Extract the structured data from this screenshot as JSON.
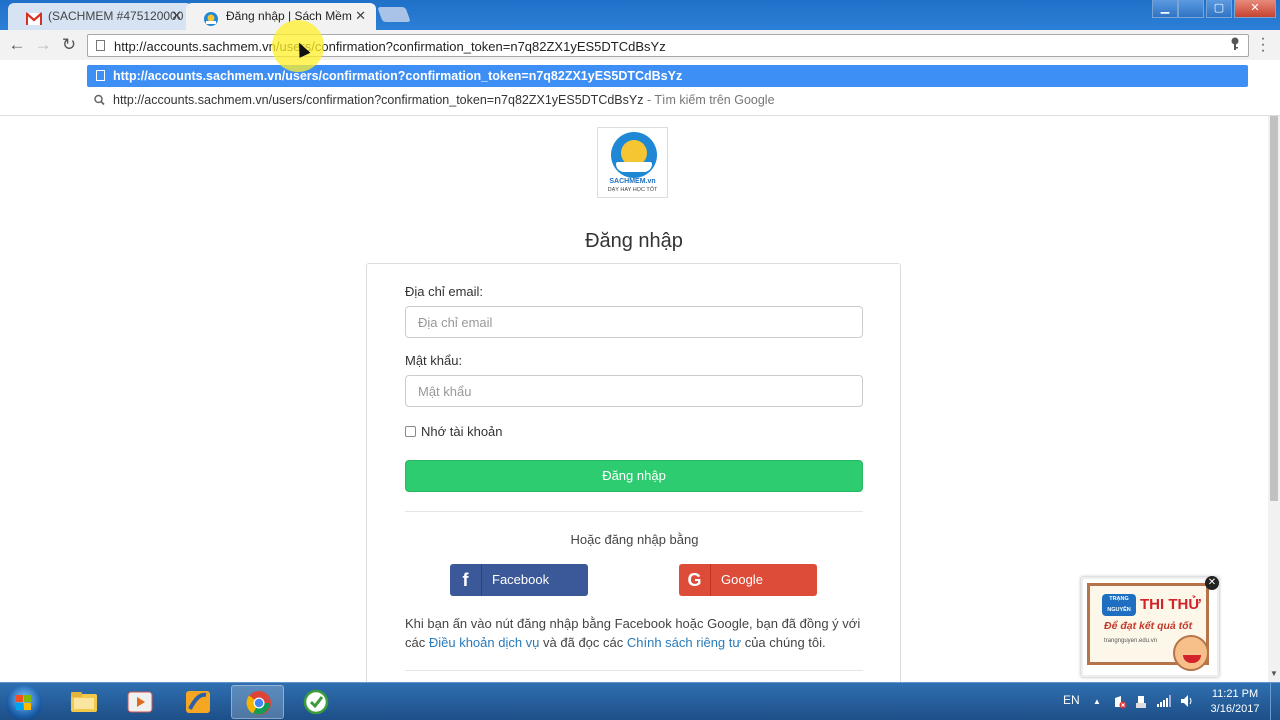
{
  "browser": {
    "tabs": [
      {
        "title": "(SACHMEM #475120000",
        "favicon": "gmail-icon"
      },
      {
        "title": "Đăng nhập | Sách Mềm",
        "favicon": "sachmem-icon",
        "active": true
      }
    ],
    "close_glyph": "✕",
    "window_buttons": {
      "minimize": "▁",
      "maximize": "▢",
      "close": "✕"
    },
    "nav": {
      "back": "←",
      "forward": "→",
      "reload": "↻"
    },
    "address": "http://accounts.sachmem.vn/users/confirmation?confirmation_token=n7q82ZX1yES5DTCdBsYz",
    "key_icon": "key-icon",
    "suggestions": [
      {
        "text": "http://accounts.sachmem.vn/users/confirmation?confirmation_token=n7q82ZX1yES5DTCdBsYz"
      },
      {
        "text": "http://accounts.sachmem.vn/users/confirmation?confirmation_token=n7q82ZX1yES5DTCdBsYz",
        "hint": " - Tìm kiếm trên Google"
      }
    ]
  },
  "logo": {
    "brand": "SACHMEM.vn",
    "slogan": "DẠY HAY HỌC TỐT"
  },
  "login": {
    "title": "Đăng nhập",
    "email_label": "Địa chỉ email:",
    "email_placeholder": "Địa chỉ email",
    "password_label": "Mật khẩu:",
    "password_placeholder": "Mật khẩu",
    "remember_label": "Nhớ tài khoản",
    "submit_label": "Đăng nhập",
    "or_label": "Hoặc đăng nhập bằng",
    "facebook_label": "Facebook",
    "facebook_glyph": "f",
    "google_label": "Google",
    "google_glyph": "G",
    "terms_prefix": "Khi bạn ấn vào nút đăng nhập bằng Facebook hoặc Google, bạn đã đồng ý với các ",
    "terms_link": "Điều khoản dịch vụ",
    "terms_mid": " và đã đọc các ",
    "privacy_link": "Chính sách riêng tư",
    "terms_suffix": " của chúng tôi."
  },
  "ad": {
    "logo_text": "TRẠNG NGUYÊN",
    "title": "THI THỬ",
    "subtitle": "Để đạt kết quả tốt",
    "site": "trangnguyen.edu.vn",
    "close_glyph": "✕"
  },
  "taskbar": {
    "language": "EN",
    "time": "11:21 PM",
    "date": "3/16/2017",
    "tray_up_glyph": "▲"
  },
  "colors": {
    "login_button": "#2ecc71",
    "facebook": "#3b5998",
    "google": "#dd4b39",
    "suggestion_highlight": "#3d8ff6",
    "link": "#2a7ab8"
  }
}
